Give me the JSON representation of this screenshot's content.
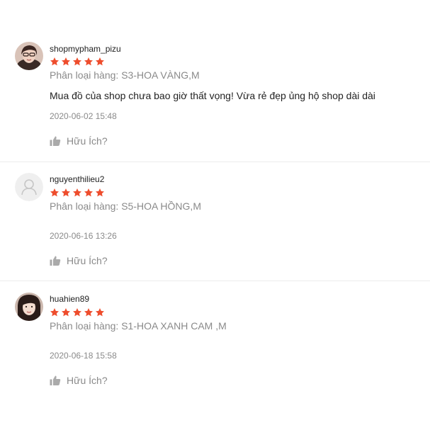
{
  "colors": {
    "star": "#ee4d2d",
    "muted_text": "#8a8a8a",
    "divider": "#ececec"
  },
  "reviews": [
    {
      "username": "shopmypham_pizu",
      "rating": 5,
      "variation": "Phân loại hàng: S3-HOA VÀNG,M",
      "comment": "Mua đồ của shop chưa bao giờ thất vọng! Vừa rẻ đẹp ủng hộ shop dài dài",
      "timestamp": "2020-06-02 15:48",
      "helpful_label": "Hữu Ích?",
      "avatar": "user-photo"
    },
    {
      "username": "nguyenthilieu2",
      "rating": 5,
      "variation": "Phân loại hàng: S5-HOA HỒNG,M",
      "timestamp": "2020-06-16 13:26",
      "helpful_label": "Hữu Ích?",
      "avatar": "default-user-icon"
    },
    {
      "username": "huahien89",
      "rating": 5,
      "variation": "Phân loại hàng: S1-HOA XANH CAM ,M",
      "timestamp": "2020-06-18 15:58",
      "helpful_label": "Hữu Ích?",
      "avatar": "user-photo"
    }
  ]
}
